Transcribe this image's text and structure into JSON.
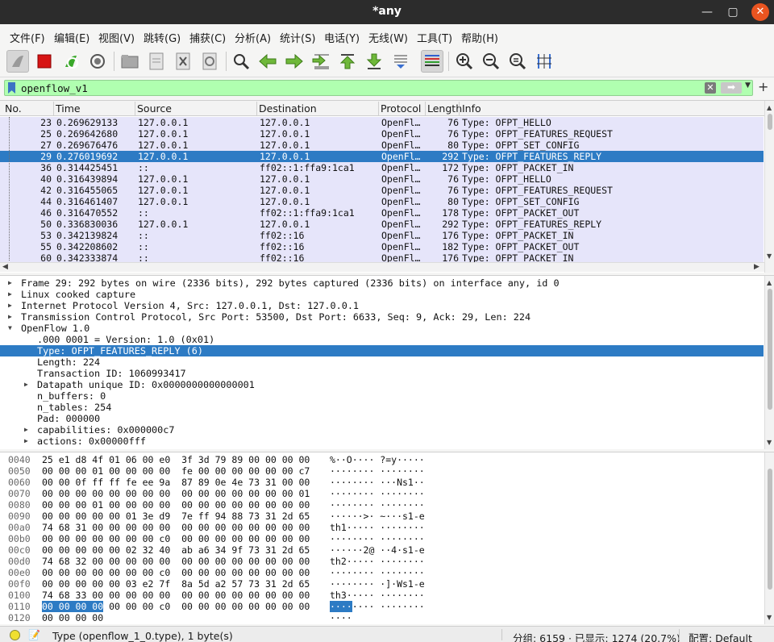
{
  "window": {
    "title": "*any"
  },
  "menu": [
    "文件(F)",
    "编辑(E)",
    "视图(V)",
    "跳转(G)",
    "捕获(C)",
    "分析(A)",
    "统计(S)",
    "电话(Y)",
    "无线(W)",
    "工具(T)",
    "帮助(H)"
  ],
  "filter": {
    "value": "openflow_v1"
  },
  "columns": {
    "no": "No.",
    "time": "Time",
    "source": "Source",
    "destination": "Destination",
    "protocol": "Protocol",
    "length": "Length",
    "info": "Info"
  },
  "packets": [
    {
      "no": "23",
      "time": "0.269629133",
      "src": "127.0.0.1",
      "dst": "127.0.0.1",
      "proto": "OpenFl…",
      "len": "76",
      "info": "Type: OFPT_HELLO"
    },
    {
      "no": "25",
      "time": "0.269642680",
      "src": "127.0.0.1",
      "dst": "127.0.0.1",
      "proto": "OpenFl…",
      "len": "76",
      "info": "Type: OFPT_FEATURES_REQUEST"
    },
    {
      "no": "27",
      "time": "0.269676476",
      "src": "127.0.0.1",
      "dst": "127.0.0.1",
      "proto": "OpenFl…",
      "len": "80",
      "info": "Type: OFPT_SET_CONFIG"
    },
    {
      "no": "29",
      "time": "0.276019692",
      "src": "127.0.0.1",
      "dst": "127.0.0.1",
      "proto": "OpenFl…",
      "len": "292",
      "info": "Type: OFPT_FEATURES_REPLY"
    },
    {
      "no": "36",
      "time": "0.314425451",
      "src": "::",
      "dst": "ff02::1:ffa9:1ca1",
      "proto": "OpenFl…",
      "len": "172",
      "info": "Type: OFPT_PACKET_IN"
    },
    {
      "no": "40",
      "time": "0.316439894",
      "src": "127.0.0.1",
      "dst": "127.0.0.1",
      "proto": "OpenFl…",
      "len": "76",
      "info": "Type: OFPT_HELLO"
    },
    {
      "no": "42",
      "time": "0.316455065",
      "src": "127.0.0.1",
      "dst": "127.0.0.1",
      "proto": "OpenFl…",
      "len": "76",
      "info": "Type: OFPT_FEATURES_REQUEST"
    },
    {
      "no": "44",
      "time": "0.316461407",
      "src": "127.0.0.1",
      "dst": "127.0.0.1",
      "proto": "OpenFl…",
      "len": "80",
      "info": "Type: OFPT_SET_CONFIG"
    },
    {
      "no": "46",
      "time": "0.316470552",
      "src": "::",
      "dst": "ff02::1:ffa9:1ca1",
      "proto": "OpenFl…",
      "len": "178",
      "info": "Type: OFPT_PACKET_OUT"
    },
    {
      "no": "50",
      "time": "0.336830036",
      "src": "127.0.0.1",
      "dst": "127.0.0.1",
      "proto": "OpenFl…",
      "len": "292",
      "info": "Type: OFPT_FEATURES_REPLY"
    },
    {
      "no": "53",
      "time": "0.342139824",
      "src": "::",
      "dst": "ff02::16",
      "proto": "OpenFl…",
      "len": "176",
      "info": "Type: OFPT_PACKET_IN"
    },
    {
      "no": "55",
      "time": "0.342208602",
      "src": "::",
      "dst": "ff02::16",
      "proto": "OpenFl…",
      "len": "182",
      "info": "Type: OFPT_PACKET_OUT"
    },
    {
      "no": "60",
      "time": "0.342333874",
      "src": "::",
      "dst": "ff02::16",
      "proto": "OpenFl…",
      "len": "176",
      "info": "Type: OFPT_PACKET_IN"
    }
  ],
  "selected_packet_index": 3,
  "details": [
    {
      "text": "Frame 29: 292 bytes on wire (2336 bits), 292 bytes captured (2336 bits) on interface any, id 0",
      "level": 0,
      "tree": "collapsed"
    },
    {
      "text": "Linux cooked capture",
      "level": 0,
      "tree": "collapsed"
    },
    {
      "text": "Internet Protocol Version 4, Src: 127.0.0.1, Dst: 127.0.0.1",
      "level": 0,
      "tree": "collapsed"
    },
    {
      "text": "Transmission Control Protocol, Src Port: 53500, Dst Port: 6633, Seq: 9, Ack: 29, Len: 224",
      "level": 0,
      "tree": "collapsed"
    },
    {
      "text": "OpenFlow 1.0",
      "level": 0,
      "tree": "expanded"
    },
    {
      "text": ".000 0001 = Version: 1.0 (0x01)",
      "level": 1,
      "tree": "none"
    },
    {
      "text": "Type: OFPT_FEATURES_REPLY (6)",
      "level": 1,
      "tree": "none",
      "selected": true
    },
    {
      "text": "Length: 224",
      "level": 1,
      "tree": "none"
    },
    {
      "text": "Transaction ID: 1060993417",
      "level": 1,
      "tree": "none"
    },
    {
      "text": "Datapath unique ID: 0x0000000000000001",
      "level": 1,
      "tree": "collapsed"
    },
    {
      "text": "n_buffers: 0",
      "level": 1,
      "tree": "none"
    },
    {
      "text": "n_tables: 254",
      "level": 1,
      "tree": "none"
    },
    {
      "text": "Pad: 000000",
      "level": 1,
      "tree": "none"
    },
    {
      "text": "capabilities: 0x000000c7",
      "level": 1,
      "tree": "collapsed"
    },
    {
      "text": "actions: 0x00000fff",
      "level": 1,
      "tree": "collapsed"
    }
  ],
  "hex_rows": [
    {
      "off": "0040",
      "bytes": "25 e1 d8 4f 01 06 00 e0  3f 3d 79 89 00 00 00 00",
      "ascii": "%··O···· ?=y·····"
    },
    {
      "off": "0050",
      "bytes": "00 00 00 01 00 00 00 00  fe 00 00 00 00 00 00 c7",
      "ascii": "········ ········"
    },
    {
      "off": "0060",
      "bytes": "00 00 0f ff ff fe ee 9a  87 89 0e 4e 73 31 00 00",
      "ascii": "········ ···Ns1··"
    },
    {
      "off": "0070",
      "bytes": "00 00 00 00 00 00 00 00  00 00 00 00 00 00 00 01",
      "ascii": "········ ········"
    },
    {
      "off": "0080",
      "bytes": "00 00 00 01 00 00 00 00  00 00 00 00 00 00 00 00",
      "ascii": "········ ········"
    },
    {
      "off": "0090",
      "bytes": "00 00 00 00 00 01 3e d9  7e ff 94 88 73 31 2d 65",
      "ascii": "······>· ~···s1-e"
    },
    {
      "off": "00a0",
      "bytes": "74 68 31 00 00 00 00 00  00 00 00 00 00 00 00 00",
      "ascii": "th1····· ········"
    },
    {
      "off": "00b0",
      "bytes": "00 00 00 00 00 00 00 c0  00 00 00 00 00 00 00 00",
      "ascii": "········ ········"
    },
    {
      "off": "00c0",
      "bytes": "00 00 00 00 00 02 32 40  ab a6 34 9f 73 31 2d 65",
      "ascii": "······2@ ··4·s1-e"
    },
    {
      "off": "00d0",
      "bytes": "74 68 32 00 00 00 00 00  00 00 00 00 00 00 00 00",
      "ascii": "th2····· ········"
    },
    {
      "off": "00e0",
      "bytes": "00 00 00 00 00 00 00 c0  00 00 00 00 00 00 00 00",
      "ascii": "········ ········"
    },
    {
      "off": "00f0",
      "bytes": "00 00 00 00 00 03 e2 7f  8a 5d a2 57 73 31 2d 65",
      "ascii": "········ ·]·Ws1-e"
    },
    {
      "off": "0100",
      "bytes": "74 68 33 00 00 00 00 00  00 00 00 00 00 00 00 00",
      "ascii": "th3····· ········"
    },
    {
      "off": "0110",
      "bytes": "00 00 00 00 00 00 00 c0  00 00 00 00 00 00 00 00",
      "ascii": "········ ········",
      "hl_bytes": "00 00 00 00",
      "hl_ascii": "····"
    },
    {
      "off": "0120",
      "bytes": "00 00 00 00",
      "ascii": "····"
    }
  ],
  "status": {
    "field": "Type (openflow_1_0.type), 1 byte(s)",
    "packets": "分组: 6159 · 已显示: 1274 (20.7%)",
    "profile": "配置: Default"
  },
  "colors": {
    "selected_row": "#2d7bc4",
    "row_bg": "#e6e5fa",
    "filter_valid": "#b0ffb0",
    "close_button": "#e95420"
  }
}
